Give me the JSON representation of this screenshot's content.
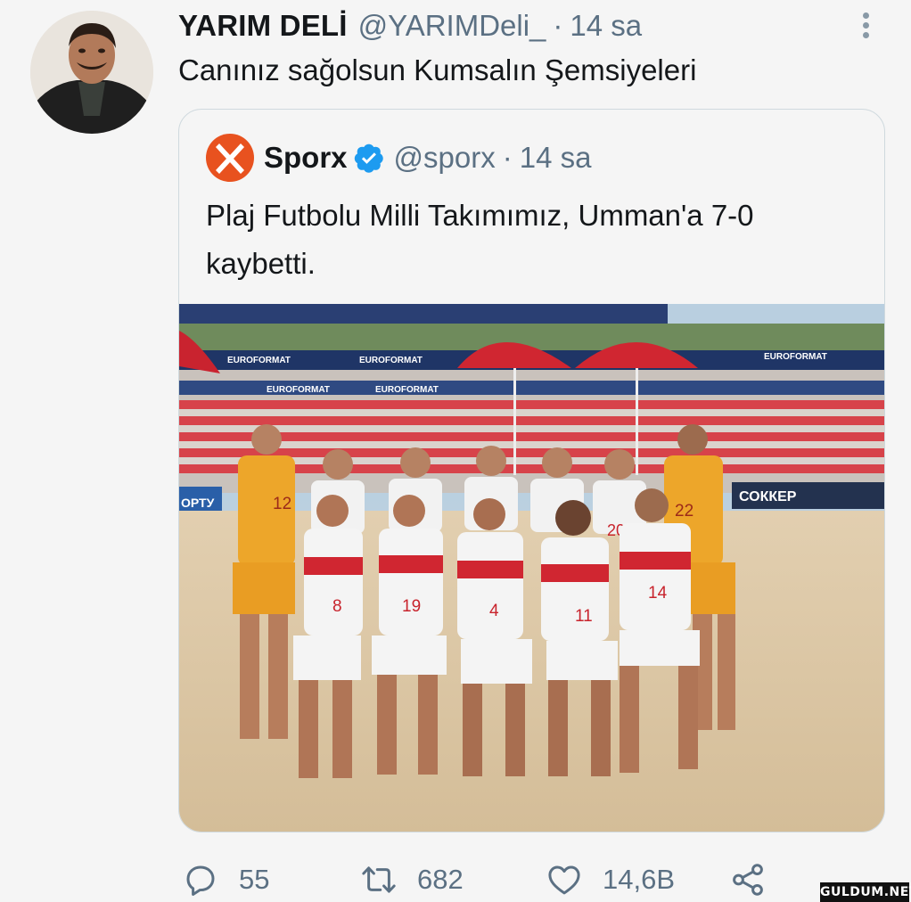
{
  "tweet": {
    "author_name": "YARIM DELİ",
    "author_handle": "@YARIMDeli_",
    "time": "14 sa",
    "text": "Canınız sağolsun Kumsalın Şemsiyeleri"
  },
  "quoted_tweet": {
    "author_name": "Sporx",
    "author_handle": "@sporx",
    "time": "14 sa",
    "text_line1": "Plaj Futbolu Milli Takımımız, Umman'a 7-0",
    "text_line2": "kaybetti.",
    "logo_text": "sporx",
    "photo_banner_texts": [
      "EUROFORMAT",
      "EUROFORMAT",
      "EUROFORMAT",
      "EUROFORMAT",
      "EUROFORMAT"
    ],
    "photo_sign_left": "ОРТУ",
    "photo_sign_right": "СОККЕР",
    "player_numbers_back": [
      "12",
      "",
      "",
      "",
      "",
      "20",
      "22"
    ],
    "player_numbers_front": [
      "8",
      "19",
      "4",
      "11",
      "14"
    ]
  },
  "actions": {
    "replies": "55",
    "retweets": "682",
    "likes": "14,6B"
  },
  "watermark": "GULDUM.NET",
  "icons": {
    "more": "more-vertical-icon",
    "reply": "reply-icon",
    "retweet": "retweet-icon",
    "like": "heart-icon",
    "share": "share-icon",
    "verified": "verified-badge-icon"
  },
  "colors": {
    "text": "#14171a",
    "secondary": "#5b7083",
    "verified": "#1d9bf0",
    "sporx_orange": "#e8521f",
    "border": "#cfd9de"
  }
}
